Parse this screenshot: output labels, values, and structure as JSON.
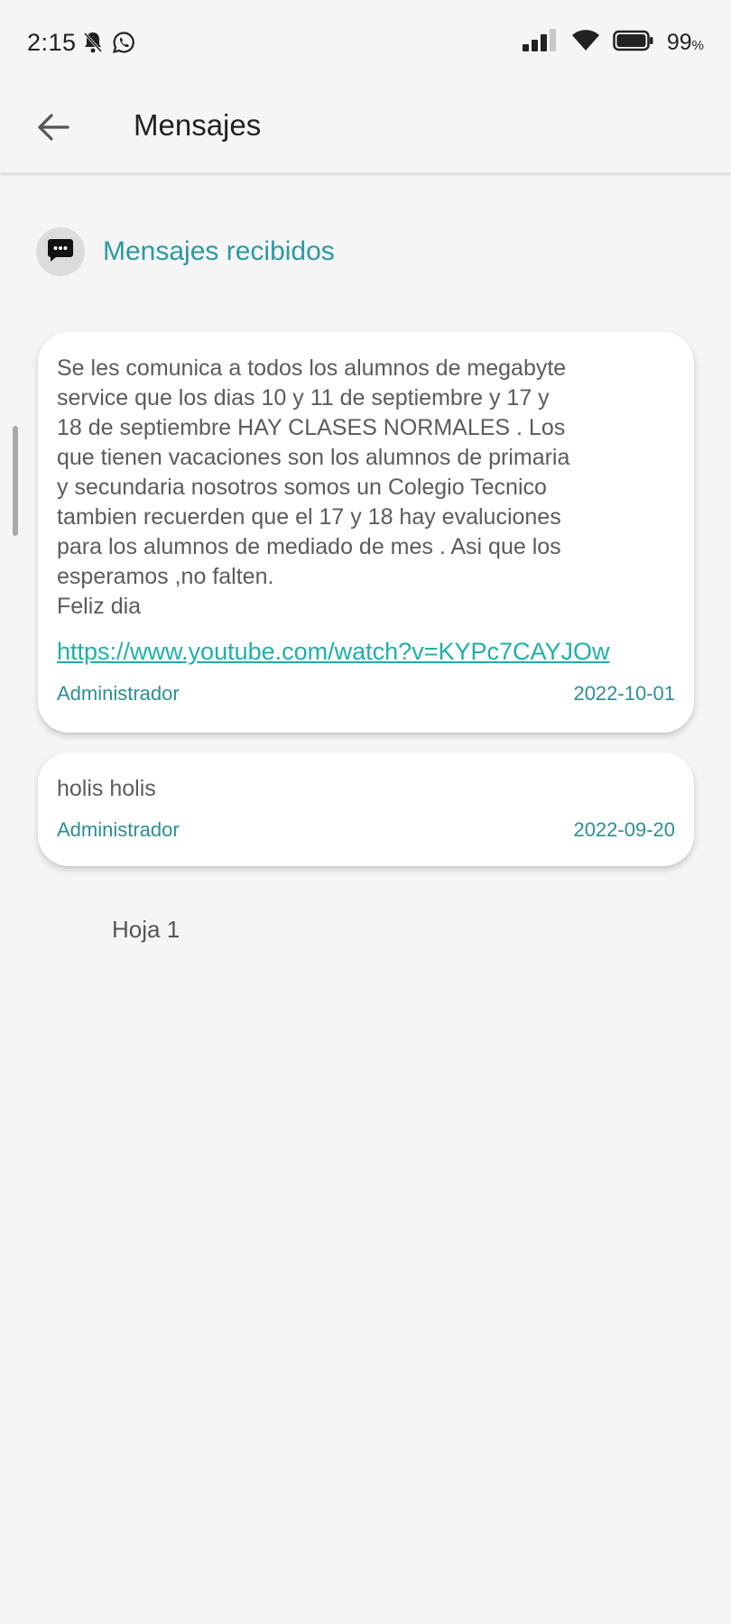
{
  "status_bar": {
    "time": "2:15",
    "battery_percent": "99",
    "battery_unit": "%",
    "icons": [
      "bell-off-icon",
      "whatsapp-icon",
      "signal-icon",
      "wifi-icon",
      "battery-icon"
    ]
  },
  "app_bar": {
    "title": "Mensajes",
    "back_icon": "arrow-back-icon"
  },
  "section": {
    "title": "Mensajes recibidos",
    "icon": "chat-bubble-icon"
  },
  "messages": [
    {
      "body": "Se les comunica a todos los alumnos de megabyte\nservice que los dias  10  y 11 de septiembre y 17 y\n18 de septiembre  HAY CLASES NORMALES . Los\nque tienen vacaciones son los alumnos de primaria\ny secundaria nosotros somos un Colegio Tecnico\ntambien recuerden que el 17 y 18 hay evaluciones\npara los alumnos de mediado de mes . Asi que los\nesperamos ,no falten.\nFeliz dia",
      "link": "https://www.youtube.com/watch?v=KYPc7CAYJOw",
      "author": "Administrador",
      "date": "2022-10-01"
    },
    {
      "body": "holis holis",
      "author": "Administrador",
      "date": "2022-09-20"
    }
  ],
  "pager": {
    "label": "Hoja 1"
  },
  "colors": {
    "accent": "#2a9aa1",
    "link": "#1fb0a8",
    "background": "#f5f5f5",
    "card": "#ffffff"
  }
}
